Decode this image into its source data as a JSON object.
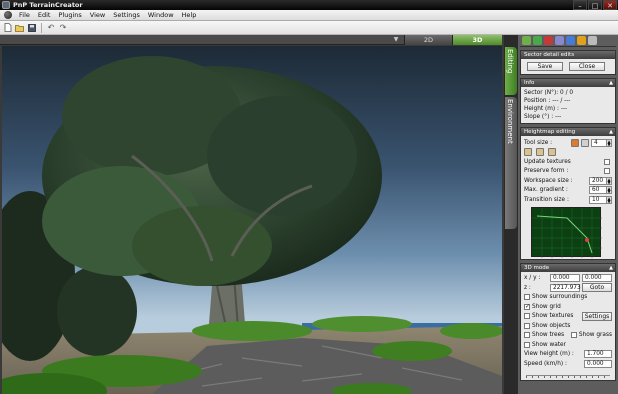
{
  "window": {
    "title": "PnP TerrainCreator",
    "minimize": "–",
    "maximize": "□",
    "close": "✕"
  },
  "menu": [
    "File",
    "Edit",
    "Plugins",
    "View",
    "Settings",
    "Window",
    "Help"
  ],
  "toolbar": {
    "icons": [
      "new-file-icon",
      "open-folder-icon",
      "save-icon",
      "undo-icon",
      "redo-icon"
    ]
  },
  "view_tabs": {
    "arrow": "▼",
    "tab_2d": "2D",
    "tab_3d": "3D"
  },
  "side_tabs": {
    "editing": "Editing",
    "environment": "Environment"
  },
  "sector_edits": {
    "title": "Sector detail edits",
    "save": "Save",
    "close": "Close"
  },
  "info": {
    "title": "Info",
    "sector": "Sector (N°): 0 / 0",
    "position": "Position : --- / ---",
    "height": "Height (m) : ---",
    "slope": "Slope (°) : ---"
  },
  "heightmap": {
    "title": "Heightmap editing",
    "tool_size_label": "Tool size :",
    "tool_size_value": "4",
    "update_textures": "Update textures",
    "preserve_form": "Preserve form :",
    "workspace_label": "Workspace size :",
    "workspace_value": "200",
    "gradient_label": "Max. gradient :",
    "gradient_value": "60",
    "transition_label": "Transition size :",
    "transition_value": "10"
  },
  "view3d": {
    "title": "3D mode",
    "xy_label": "x / y :",
    "x_value": "0.000",
    "y_value": "0.000",
    "z_label": "z :",
    "z_value": "2217.973",
    "goto": "Goto",
    "show_surroundings": "Show surroundings",
    "show_grid": "Show grid",
    "show_textures": "Show textures",
    "settings": "Settings",
    "show_objects": "Show objects",
    "show_trees": "Show trees",
    "show_grass": "Show grass",
    "show_water": "Show water",
    "view_height_label": "View height (m) :",
    "view_height_value": "1.700",
    "speed_label": "Speed (km/h) :",
    "speed_value": "0.000"
  },
  "colors": {
    "accent_green": "#5f9e36",
    "panel_bg": "#5d5d5d"
  }
}
